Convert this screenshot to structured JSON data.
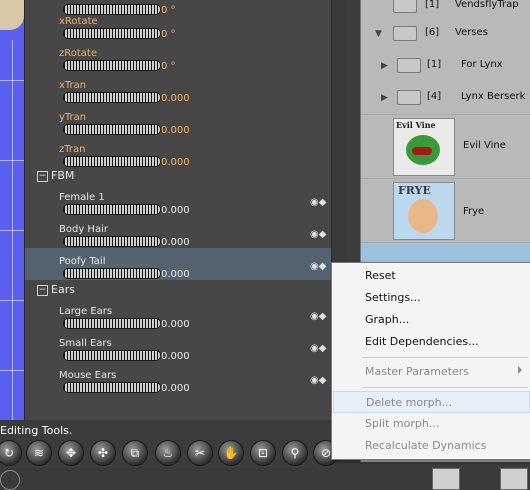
{
  "params": {
    "rows": [
      {
        "name": "",
        "value": "0 °"
      },
      {
        "name": "xRotate",
        "value": "0 °"
      },
      {
        "name": "zRotate",
        "value": "0 °"
      },
      {
        "name": "xTran",
        "value": "0.000"
      },
      {
        "name": "yTran",
        "value": "0.000"
      },
      {
        "name": "zTran",
        "value": "0.000"
      }
    ],
    "groups": [
      {
        "label": "FBM",
        "toggle": "−"
      },
      {
        "label": "Ears",
        "toggle": "−"
      }
    ],
    "fbm_rows": [
      {
        "name": "Female 1",
        "value": "0.000"
      },
      {
        "name": "Body Hair",
        "value": "0.000"
      },
      {
        "name": "Poofy Tail",
        "value": "0.000"
      }
    ],
    "ears_rows": [
      {
        "name": "Large Ears",
        "value": "0.000"
      },
      {
        "name": "Small Ears",
        "value": "0.000"
      },
      {
        "name": "Mouse Ears",
        "value": "0.000"
      }
    ],
    "key_icon": "◉◆"
  },
  "library": {
    "items": [
      {
        "count": "[1]",
        "name": "VendsflyTrap"
      },
      {
        "count": "[6]",
        "name": "Verses"
      },
      {
        "count": "[1]",
        "name": "For Lynx"
      },
      {
        "count": "[4]",
        "name": "Lynx Berserk"
      }
    ],
    "thumbs": [
      {
        "name": "Evil Vine",
        "thumb_text": "Evil Vine"
      },
      {
        "name": "Frye",
        "thumb_text": "FRYE"
      }
    ]
  },
  "status": {
    "text": "Editing Tools."
  },
  "toolbar": {
    "icons": [
      "↻",
      "≋",
      "✥",
      "✣",
      "⧉",
      "♨",
      "✂",
      "✋",
      "⊡",
      "⚲",
      "⊘"
    ]
  },
  "menu": {
    "items": [
      {
        "label": "Reset",
        "enabled": true
      },
      {
        "label": "Settings...",
        "enabled": true
      },
      {
        "label": "Graph...",
        "enabled": true
      },
      {
        "label": "Edit Dependencies...",
        "enabled": true
      },
      {
        "label": "Master Parameters",
        "enabled": false
      },
      {
        "label": "Delete morph...",
        "enabled": false
      },
      {
        "label": "Split morph...",
        "enabled": false
      },
      {
        "label": "Recalculate Dynamics",
        "enabled": false
      }
    ]
  },
  "colors": {
    "accent_selected": "#556270",
    "param_orange": "#f0b070",
    "menu_highlight": "#e6eef7"
  }
}
